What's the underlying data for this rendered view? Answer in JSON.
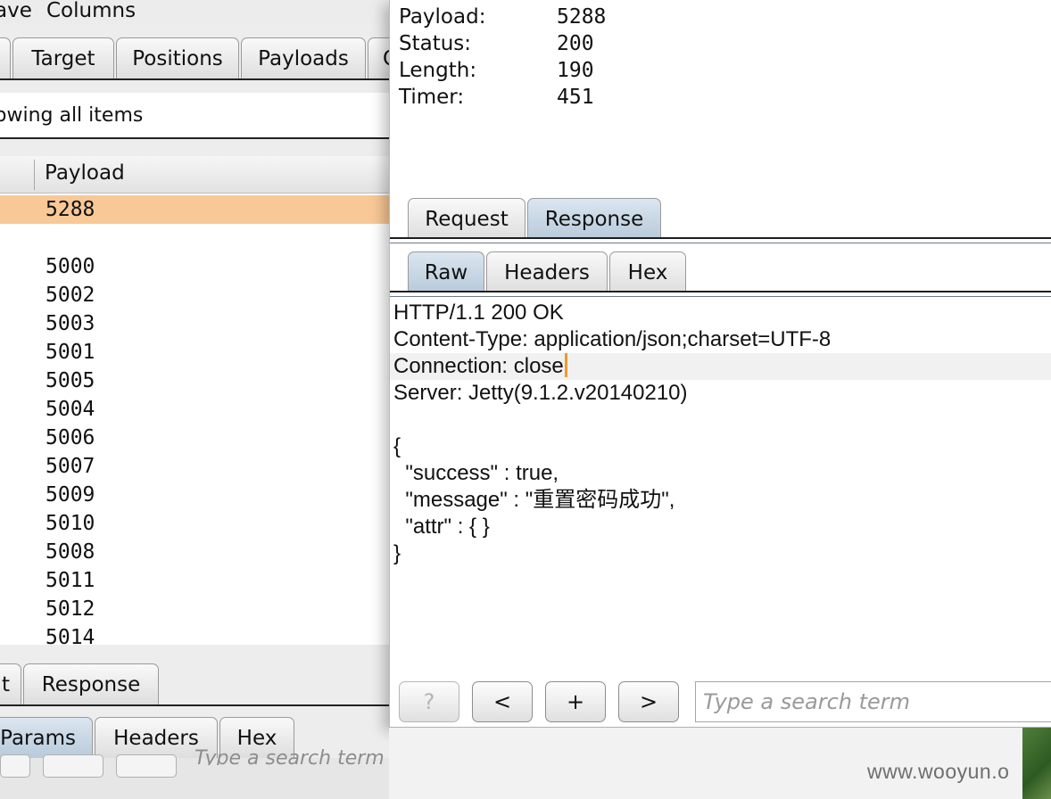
{
  "background_window": {
    "menu": {
      "save_label": "ave",
      "columns_label": "Columns"
    },
    "tabs": [
      {
        "label": ""
      },
      {
        "label": "Target"
      },
      {
        "label": "Positions"
      },
      {
        "label": "Payloads"
      },
      {
        "label": "O"
      }
    ],
    "filter_text": "owing all items",
    "table": {
      "column_header": "Payload",
      "rows": [
        "5288",
        "",
        "5000",
        "5002",
        "5003",
        "5001",
        "5005",
        "5004",
        "5006",
        "5007",
        "5009",
        "5010",
        "5008",
        "5011",
        "5012",
        "5014"
      ],
      "selected_row": 0
    },
    "message_tabs": [
      {
        "label": "t"
      },
      {
        "label": "Response"
      }
    ],
    "view_tabs": [
      {
        "label": "Params"
      },
      {
        "label": "Headers"
      },
      {
        "label": "Hex"
      }
    ],
    "search_placeholder": "Type a search term"
  },
  "result_window": {
    "info": [
      {
        "key": "Payload:",
        "value": "5288"
      },
      {
        "key": "Status:",
        "value": "200"
      },
      {
        "key": "Length:",
        "value": "190"
      },
      {
        "key": "Timer:",
        "value": "451"
      }
    ],
    "message_tabs": [
      {
        "label": "Request",
        "selected": false
      },
      {
        "label": "Response",
        "selected": true
      }
    ],
    "view_tabs": [
      {
        "label": "Raw",
        "selected": true
      },
      {
        "label": "Headers",
        "selected": false
      },
      {
        "label": "Hex",
        "selected": false
      }
    ],
    "response_lines": [
      "HTTP/1.1 200 OK",
      "Content-Type: application/json;charset=UTF-8",
      "Connection: close",
      "Server: Jetty(9.1.2.v20140210)",
      "",
      "{",
      "  \"success\" : true,",
      "  \"message\" : \"重置密码成功\",",
      "  \"attr\" : { }",
      "}"
    ],
    "buttons": {
      "help": "?",
      "prev": "<",
      "add": "+",
      "next": ">"
    },
    "search_placeholder": "Type a search term"
  },
  "watermark": "www.wooyun.o",
  "colors": {
    "selected_row": "#f8c996",
    "selected_tab": "#c7d6e4",
    "caret": "#f09a2b"
  }
}
